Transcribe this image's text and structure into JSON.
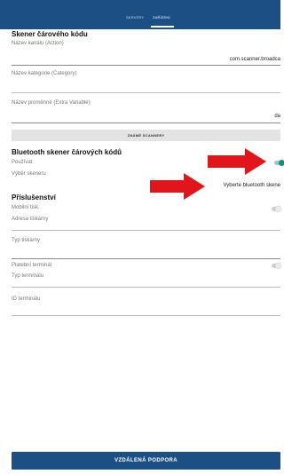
{
  "tabs": [
    {
      "label": "SERVERY",
      "active": false
    },
    {
      "label": "ZAŘÍZENÍ",
      "active": true
    }
  ],
  "barcode_scanner": {
    "title": "Skener čárového kódu",
    "action_label": "Název kanálu (Action)",
    "action_value": "com.scanner.broadca",
    "category_label": "Název kategorie (Category)",
    "category_value": "",
    "extra_label": "Název proměnné  (Extra Variable)",
    "extra_value": "da",
    "known_scanners_button": "ZNÁMÉ SCANNERY"
  },
  "bluetooth": {
    "title": "Bluetooth skener čárových kódů",
    "use_label": "Používat",
    "use_enabled": true,
    "scanner_select_label": "Výběr skeneru",
    "scanner_select_value": "Vyberte bluetooth skene"
  },
  "accessories": {
    "title": "Příslušenství",
    "mobile_print_label": "Mobilní tisk",
    "mobile_print_enabled": false,
    "printer_address_label": "Adresa tiskárny",
    "printer_type_label": "Typ tiskárny",
    "payment_terminal_label": "Platební terminál",
    "payment_terminal_enabled": false,
    "terminal_type_label": "Typ terminálu",
    "terminal_id_label": "ID terminálu"
  },
  "remote_support_button": "VZDÁLENÁ PODPORA",
  "colors": {
    "header": "#1c4f84",
    "toggle_on": "#148f86",
    "arrow": "#e0161b"
  }
}
